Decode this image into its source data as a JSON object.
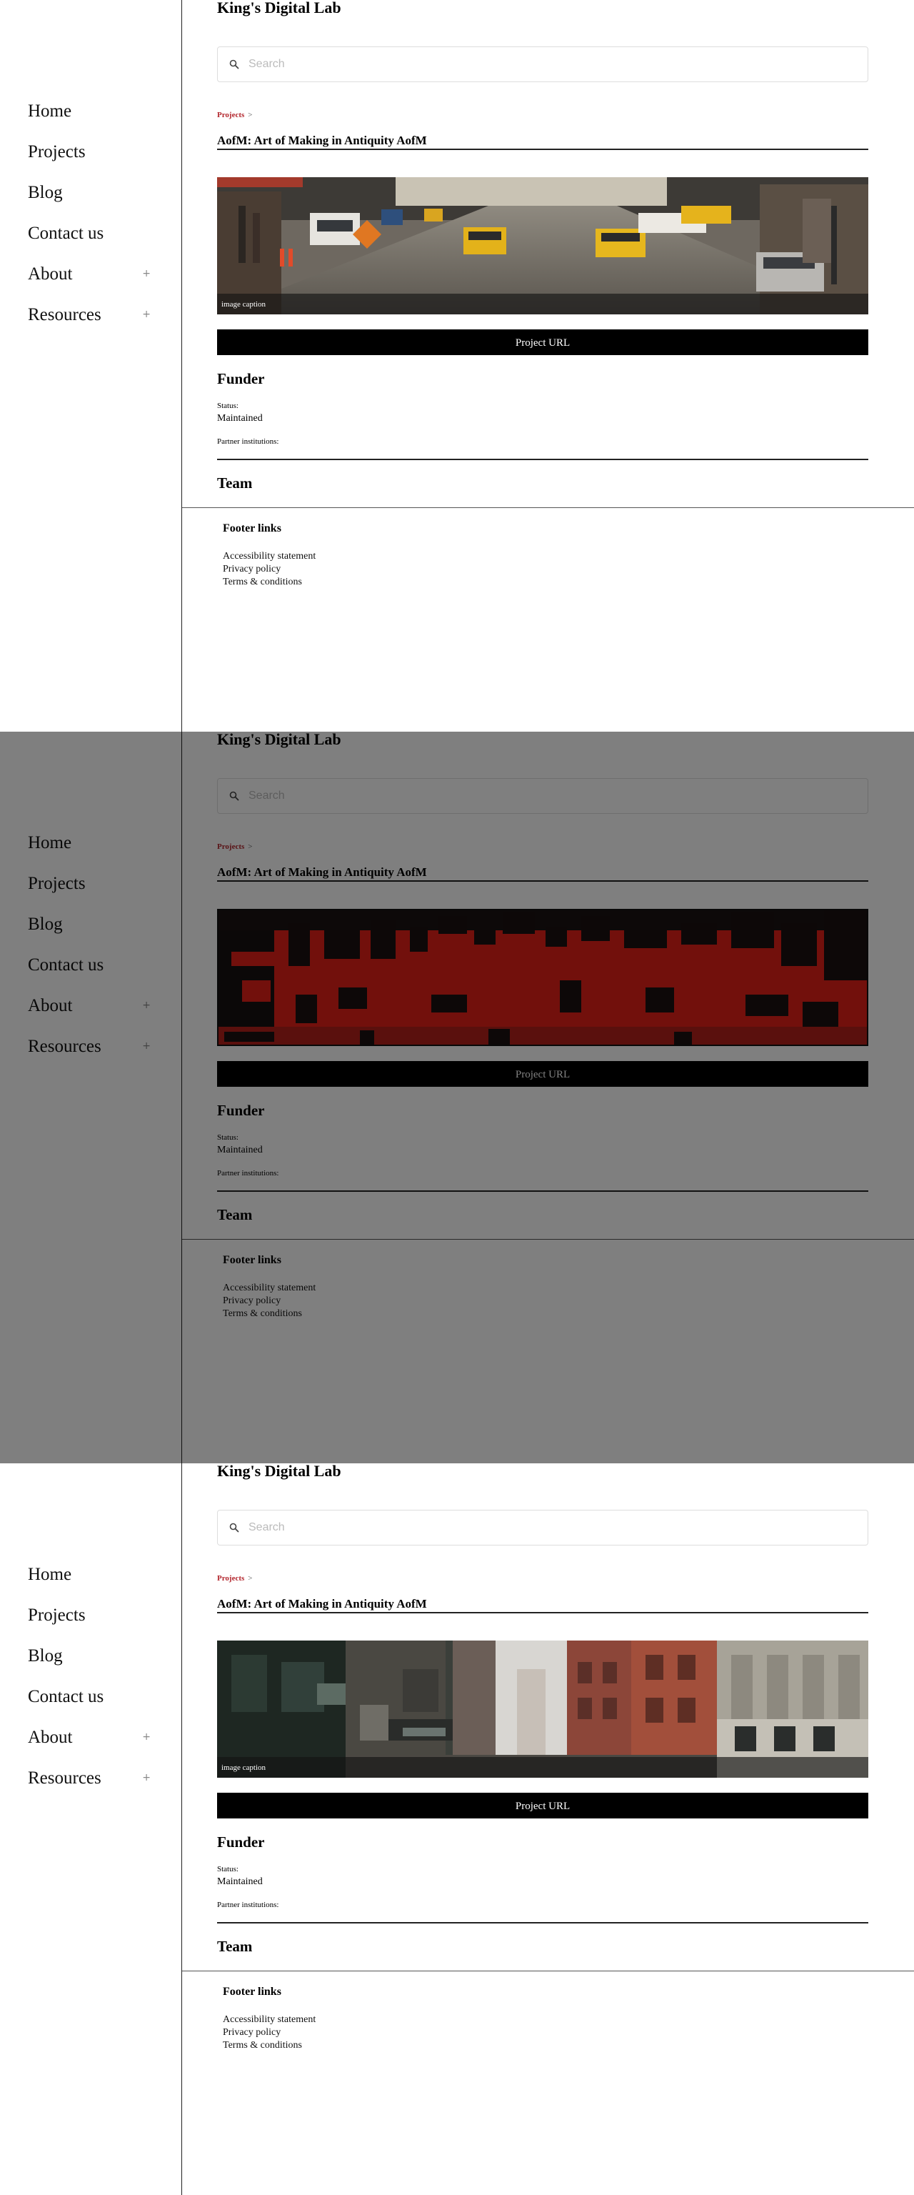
{
  "site": {
    "title": "King's Digital Lab"
  },
  "nav": {
    "items": [
      {
        "label": "Home",
        "expandable": false
      },
      {
        "label": "Projects",
        "expandable": false
      },
      {
        "label": "Blog",
        "expandable": false
      },
      {
        "label": "Contact us",
        "expandable": false
      },
      {
        "label": "About",
        "expandable": true,
        "toggle": "+"
      },
      {
        "label": "Resources",
        "expandable": true,
        "toggle": "+"
      }
    ]
  },
  "search": {
    "placeholder": "Search",
    "value": "",
    "icon": "search-icon"
  },
  "breadcrumb": {
    "link": "Projects",
    "separator": ">"
  },
  "project": {
    "title": "AofM: Art of Making in Antiquity AofM",
    "image_caption": "image caption",
    "url_button": "Project URL",
    "funder_heading": "Funder",
    "status_label": "Status:",
    "status_value": "Maintained",
    "partner_label": "Partner institutions:",
    "team_heading": "Team"
  },
  "footer": {
    "heading": "Footer links",
    "links": [
      "Accessibility statement",
      "Privacy policy",
      "Terms & conditions"
    ]
  },
  "colors": {
    "breadcrumb_link": "#b3262d",
    "button_bg": "#000000",
    "overlay": "rgba(0,0,0,0.5)"
  },
  "panels": [
    {
      "state": "default",
      "image": "street-with-taxis"
    },
    {
      "state": "overlay",
      "image": "street-with-taxis-red-filtered"
    },
    {
      "state": "default",
      "image": "city-street-buildings"
    }
  ]
}
